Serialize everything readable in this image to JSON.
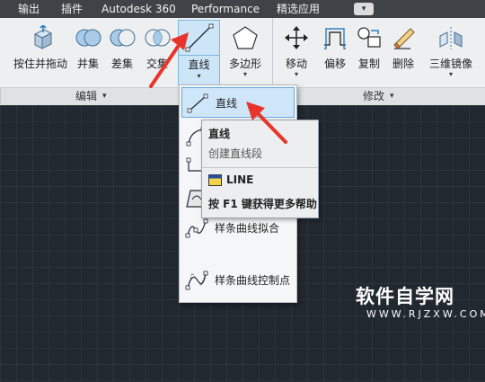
{
  "menubar": {
    "items": [
      "输出",
      "插件",
      "Autodesk 360",
      "Performance",
      "精选应用"
    ],
    "dropdown_glyph": "▾"
  },
  "ribbon": {
    "left_tools": [
      {
        "label": "按住并拖动",
        "icon": "presspull-icon"
      },
      {
        "label": "并集",
        "icon": "union-icon"
      },
      {
        "label": "差集",
        "icon": "subtract-icon"
      },
      {
        "label": "交集",
        "icon": "intersect-icon"
      }
    ],
    "line_tool": {
      "label": "直线",
      "icon": "line-icon",
      "state": "pressed"
    },
    "polygon_tool": {
      "label": "多边形",
      "icon": "polygon-icon"
    },
    "modify_tools": [
      {
        "label": "移动",
        "icon": "move-icon"
      },
      {
        "label": "偏移",
        "icon": "offset-icon"
      },
      {
        "label": "复制",
        "icon": "copy-icon"
      },
      {
        "label": "删除",
        "icon": "erase-icon"
      },
      {
        "label": "三维镜像",
        "icon": "mirror3d-icon"
      }
    ],
    "panels": {
      "edit": "编辑",
      "modify": "修改",
      "arrow": "▾"
    }
  },
  "dropdown": {
    "items": [
      {
        "label": "直线",
        "icon": "line-icon",
        "highlighted": true
      },
      {
        "label": "",
        "icon": "arc-icon"
      },
      {
        "label": "",
        "icon": "polyline-icon"
      },
      {
        "label": "",
        "icon": "region-icon"
      },
      {
        "label": "样条曲线拟合",
        "icon": "spline-fit-icon"
      },
      {
        "label": "样条曲线控制点",
        "icon": "spline-cv-icon"
      }
    ]
  },
  "tooltip": {
    "title": "直线",
    "description": "创建直线段",
    "command": "LINE",
    "help": "按 F1 键获得更多帮助"
  },
  "watermark": {
    "main": "软件自学网",
    "sub": "WWW.RJZXW.COM"
  },
  "colors": {
    "menubar_bg": "#3f4347",
    "ribbon_bg": "#eeeff0",
    "canvas_bg": "#212830",
    "highlight": "#cfe6f8",
    "annotation_arrow": "#e8342a"
  },
  "chevron": "▾"
}
